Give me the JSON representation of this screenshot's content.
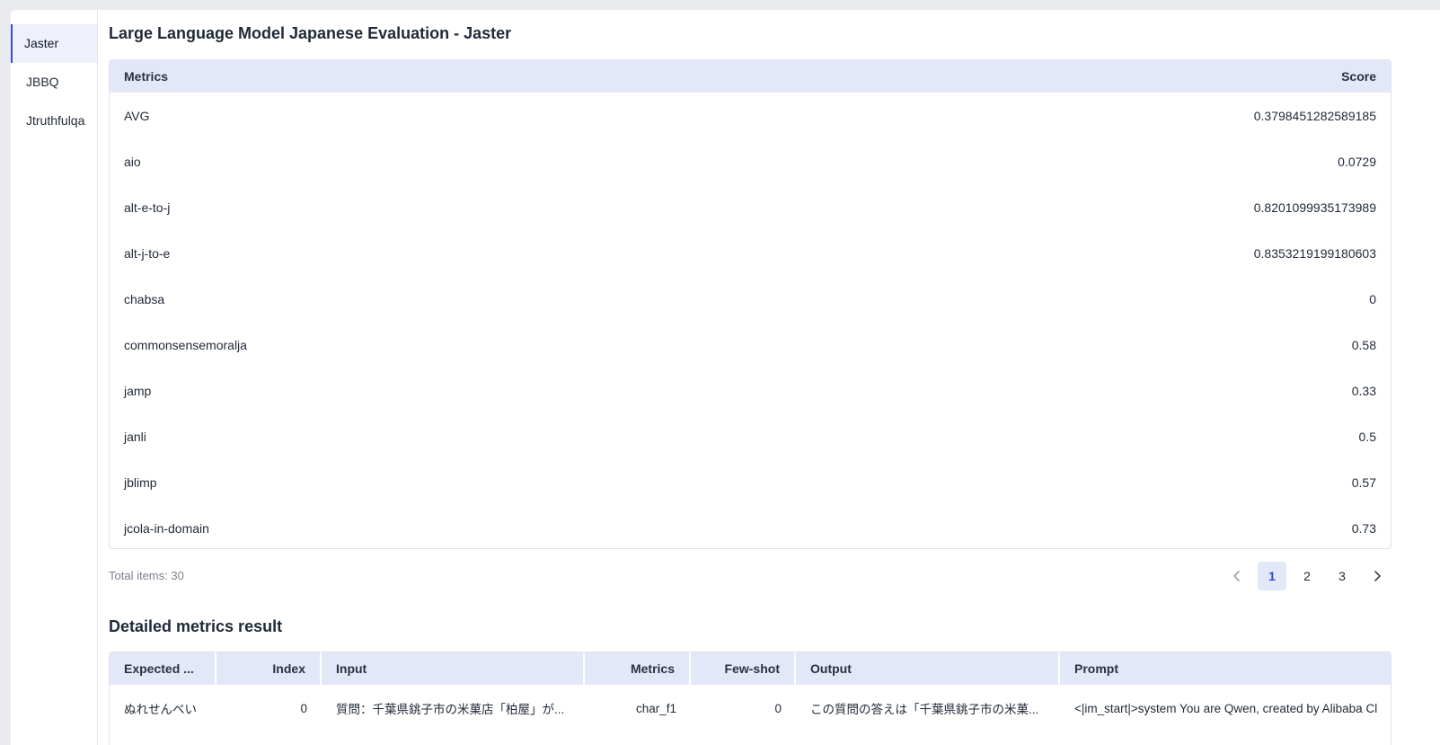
{
  "sidebar": {
    "items": [
      {
        "label": "Jaster"
      },
      {
        "label": "JBBQ"
      },
      {
        "label": "Jtruthfulqa"
      }
    ]
  },
  "page": {
    "title": "Large Language Model Japanese Evaluation - Jaster"
  },
  "metrics_table": {
    "columns": [
      "Metrics",
      "Score"
    ],
    "rows": [
      {
        "metric": "AVG",
        "score": "0.3798451282589185"
      },
      {
        "metric": "aio",
        "score": "0.0729"
      },
      {
        "metric": "alt-e-to-j",
        "score": "0.8201099935173989"
      },
      {
        "metric": "alt-j-to-e",
        "score": "0.8353219199180603"
      },
      {
        "metric": "chabsa",
        "score": "0"
      },
      {
        "metric": "commonsensemoralja",
        "score": "0.58"
      },
      {
        "metric": "jamp",
        "score": "0.33"
      },
      {
        "metric": "janli",
        "score": "0.5"
      },
      {
        "metric": "jblimp",
        "score": "0.57"
      },
      {
        "metric": "jcola-in-domain",
        "score": "0.73"
      }
    ]
  },
  "pagination": {
    "total_label": "Total items: 30",
    "pages": [
      "1",
      "2",
      "3"
    ],
    "current": "1"
  },
  "detail": {
    "title": "Detailed metrics result",
    "columns": [
      "Expected ...",
      "Index",
      "Input",
      "Metrics",
      "Few-shot",
      "Output",
      "Prompt"
    ],
    "rows": [
      {
        "expected": "ぬれせんべい",
        "index": "0",
        "input": "質問：千葉県銚子市の米菓店「柏屋」が...",
        "metrics": "char_f1",
        "few_shot": "0",
        "output": "この質問の答えは「千葉県銚子市の米菓...",
        "prompt": "<|im_start|>system You are Qwen, created by Alibaba Cl"
      }
    ]
  },
  "colors": {
    "accent": "#3b4cca",
    "header_bg": "#e3e8f9",
    "page_bg": "#e9ebef"
  }
}
